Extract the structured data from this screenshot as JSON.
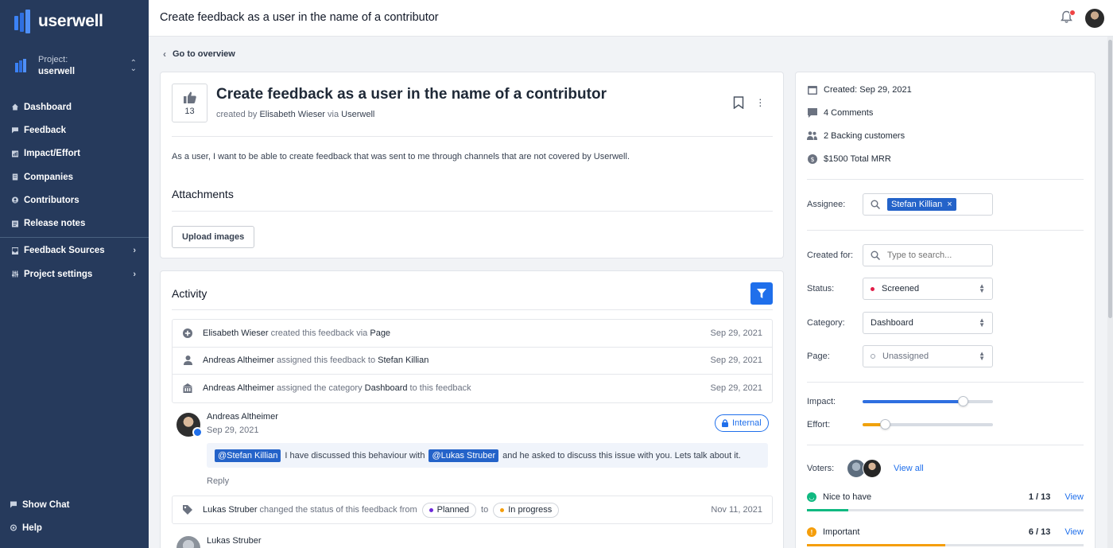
{
  "app": {
    "name": "userwell"
  },
  "project": {
    "label": "Project:",
    "name": "userwell"
  },
  "nav": {
    "items": [
      {
        "label": "Dashboard",
        "icon": "home-icon"
      },
      {
        "label": "Feedback",
        "icon": "feedback-icon"
      },
      {
        "label": "Impact/Effort",
        "icon": "chart-icon"
      },
      {
        "label": "Companies",
        "icon": "building-icon"
      },
      {
        "label": "Contributors",
        "icon": "user-icon"
      },
      {
        "label": "Release notes",
        "icon": "notes-icon"
      }
    ],
    "groups": [
      {
        "label": "Feedback Sources",
        "icon": "inbox-icon"
      },
      {
        "label": "Project settings",
        "icon": "settings-icon"
      }
    ],
    "bottom": [
      {
        "label": "Show Chat",
        "icon": "chat-icon"
      },
      {
        "label": "Help",
        "icon": "help-icon"
      }
    ]
  },
  "topbar": {
    "title": "Create feedback as a user in the name of a contributor"
  },
  "back": {
    "label": "Go to overview"
  },
  "feedback": {
    "votes": "13",
    "title": "Create feedback as a user in the name of a contributor",
    "created_by_prefix": "created by",
    "author": "Elisabeth Wieser",
    "via_word": "via",
    "source": "Userwell",
    "description": "As a user, I want to be able to create feedback that was sent to me through channels that are not covered by Userwell.",
    "attachments_title": "Attachments",
    "upload_label": "Upload images"
  },
  "activity": {
    "title": "Activity",
    "events": [
      {
        "actor": "Elisabeth Wieser",
        "text": "created this feedback via",
        "target": "Page",
        "suffix": "",
        "date": "Sep 29, 2021",
        "icon": "plus-circle-icon"
      },
      {
        "actor": "Andreas Altheimer",
        "text": "assigned this feedback to",
        "target": "Stefan Killian",
        "suffix": "",
        "date": "Sep 29, 2021",
        "icon": "person-icon"
      },
      {
        "actor": "Andreas Altheimer",
        "text": "assigned the category",
        "target": "Dashboard",
        "suffix": "to this feedback",
        "date": "Sep 29, 2021",
        "icon": "building-icon"
      }
    ],
    "comment": {
      "author": "Andreas Altheimer",
      "date": "Sep 29, 2021",
      "badge": "Internal",
      "mention1": "@Stefan Killian",
      "text1": "I have discussed this behaviour with",
      "mention2": "@Lukas Struber",
      "text2": "and he asked to discuss this issue with you. Lets talk about it.",
      "reply": "Reply"
    },
    "status_event": {
      "actor": "Lukas Struber",
      "text": "changed the status of this feedback from",
      "from": "Planned",
      "to_word": "to",
      "to": "In progress",
      "date": "Nov 11, 2021",
      "from_color": "#6d28d9",
      "to_color": "#f59e0b"
    },
    "next_comment_author": "Lukas Struber"
  },
  "side": {
    "created": "Created: Sep 29, 2021",
    "comments": "4 Comments",
    "backing": "2 Backing customers",
    "mrr": "$1500 Total MRR",
    "assignee_label": "Assignee:",
    "assignee": "Stefan Killian",
    "created_for_label": "Created for:",
    "created_for_placeholder": "Type to search...",
    "status_label": "Status:",
    "status": "Screened",
    "status_color": "#e11d48",
    "category_label": "Category:",
    "category": "Dashboard",
    "page_label": "Page:",
    "page": "Unassigned",
    "impact_label": "Impact:",
    "impact_value": 0.77,
    "impact_color": "#2f6fe0",
    "effort_label": "Effort:",
    "effort_value": 0.17,
    "effort_color": "#f0a20c",
    "voters_label": "Voters:",
    "view_all": "View all",
    "priorities": [
      {
        "label": "Nice to have",
        "count": "1 / 13",
        "view": "View",
        "color": "#10b981",
        "fraction": 0.15
      },
      {
        "label": "Important",
        "count": "6 / 13",
        "view": "View",
        "color": "#f59e0b",
        "fraction": 0.5
      }
    ]
  }
}
